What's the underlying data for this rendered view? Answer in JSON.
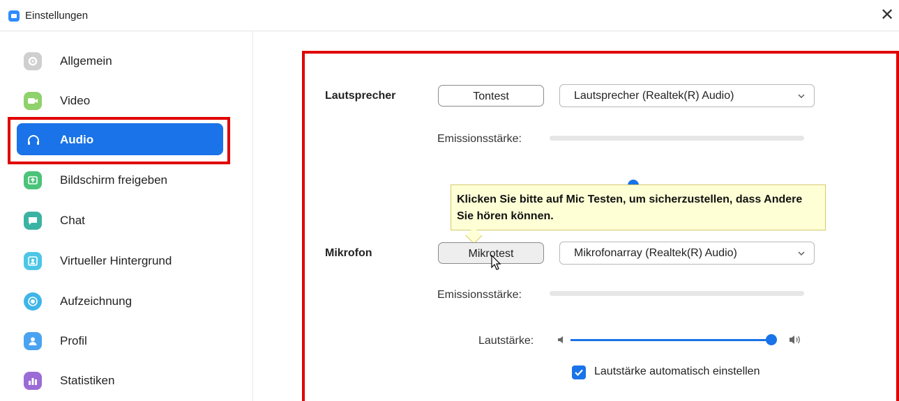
{
  "window": {
    "title": "Einstellungen"
  },
  "sidebar": {
    "items": [
      {
        "label": "Allgemein",
        "icon": "gear-icon",
        "color": "#cfcfcf"
      },
      {
        "label": "Video",
        "icon": "video-icon",
        "color": "#8fd16a"
      },
      {
        "label": "Audio",
        "icon": "headphones-icon",
        "color": "#1a73e8",
        "active": true
      },
      {
        "label": "Bildschirm freigeben",
        "icon": "share-screen-icon",
        "color": "#4cc37a"
      },
      {
        "label": "Chat",
        "icon": "chat-icon",
        "color": "#3bb3a3"
      },
      {
        "label": "Virtueller Hintergrund",
        "icon": "virtual-background-icon",
        "color": "#4cc6e6"
      },
      {
        "label": "Aufzeichnung",
        "icon": "record-icon",
        "color": "#3fb5e8"
      },
      {
        "label": "Profil",
        "icon": "profile-icon",
        "color": "#4aa3f0"
      },
      {
        "label": "Statistiken",
        "icon": "statistics-icon",
        "color": "#9b6bd6"
      }
    ]
  },
  "speaker": {
    "label": "Lautsprecher",
    "test_button": "Tontest",
    "device": "Lautsprecher (Realtek(R) Audio)",
    "output_level_label": "Emissionsstärke:"
  },
  "tooltip": {
    "text": "Klicken Sie bitte auf Mic Testen, um sicherzustellen, dass Andere Sie hören können."
  },
  "microphone": {
    "label": "Mikrofon",
    "test_button": "Mikrotest",
    "device": "Mikrofonarray (Realtek(R) Audio)",
    "input_level_label": "Emissionsstärke:",
    "volume_label": "Lautstärke:",
    "volume_level": 1.0,
    "auto_adjust_label": "Lautstärke automatisch einstellen",
    "auto_adjust_checked": true
  },
  "colors": {
    "accent": "#1a73e8",
    "highlight": "#e00000",
    "tooltip_bg": "#ffffd6"
  }
}
